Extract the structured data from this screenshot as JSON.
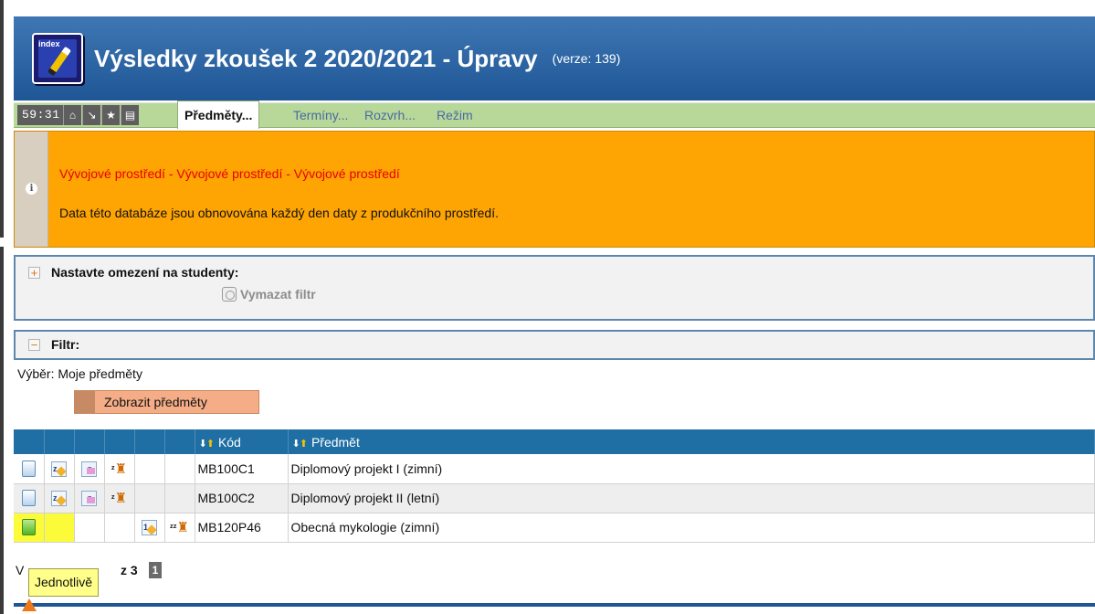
{
  "window": {
    "title": "Výsledky zkoušek 2 2020/2021 - Úpravy",
    "version": "(verze: 139)",
    "app_icon_label": "index"
  },
  "toolbar": {
    "timer": "59:31",
    "tools": [
      {
        "icon": "home-icon",
        "glyph": "⌂"
      },
      {
        "icon": "arrow-down-right-icon",
        "glyph": "↘"
      },
      {
        "icon": "star-icon",
        "glyph": "★"
      },
      {
        "icon": "print-icon",
        "glyph": "▤"
      }
    ],
    "tabs": [
      {
        "label": "Předměty...",
        "active": true
      },
      {
        "label": "Termíny...",
        "active": false
      },
      {
        "label": "Rozvrh...",
        "active": false
      },
      {
        "label": "Režim",
        "active": false
      }
    ]
  },
  "warning": {
    "title": "Vývojové prostředí - Vývojové prostředí - Vývojové prostředí",
    "text": "Data této databáze jsou obnovována každý den daty z produkčního prostředí.",
    "icon": "i"
  },
  "student_filter": {
    "toggle": "+",
    "heading": "Nastavte omezení na studenty:",
    "clear_label": "Vymazat filtr"
  },
  "filter": {
    "toggle": "−",
    "heading": "Filtr:",
    "selection": "Výběr: Moje předměty",
    "show_button": "Zobrazit předměty"
  },
  "table": {
    "sort_glyph_down": "⬇",
    "sort_glyph_up": "⬆",
    "columns": [
      "Kód",
      "Předmět"
    ],
    "rows": [
      {
        "code": "MB100C1",
        "subject": "Diplomový projekt I (zimní)"
      },
      {
        "code": "MB100C2",
        "subject": "Diplomový projekt II (letní)"
      },
      {
        "code": "MB120P46",
        "subject": "Obecná mykologie (zimní)"
      }
    ],
    "icon_glyphs": {
      "z": "z",
      "zx": "zz",
      "one": "1"
    }
  },
  "pager": {
    "prefix": "V",
    "of_text": "z 3",
    "page": "1"
  },
  "tooltip": "Jednotlivě",
  "colors": {
    "header": "#1f5696",
    "tabbar": "#b8d89a",
    "warning": "#fea403",
    "warning_title": "#e60000",
    "table_header": "#1f6fa4",
    "highlight": "#fbfb3a"
  }
}
